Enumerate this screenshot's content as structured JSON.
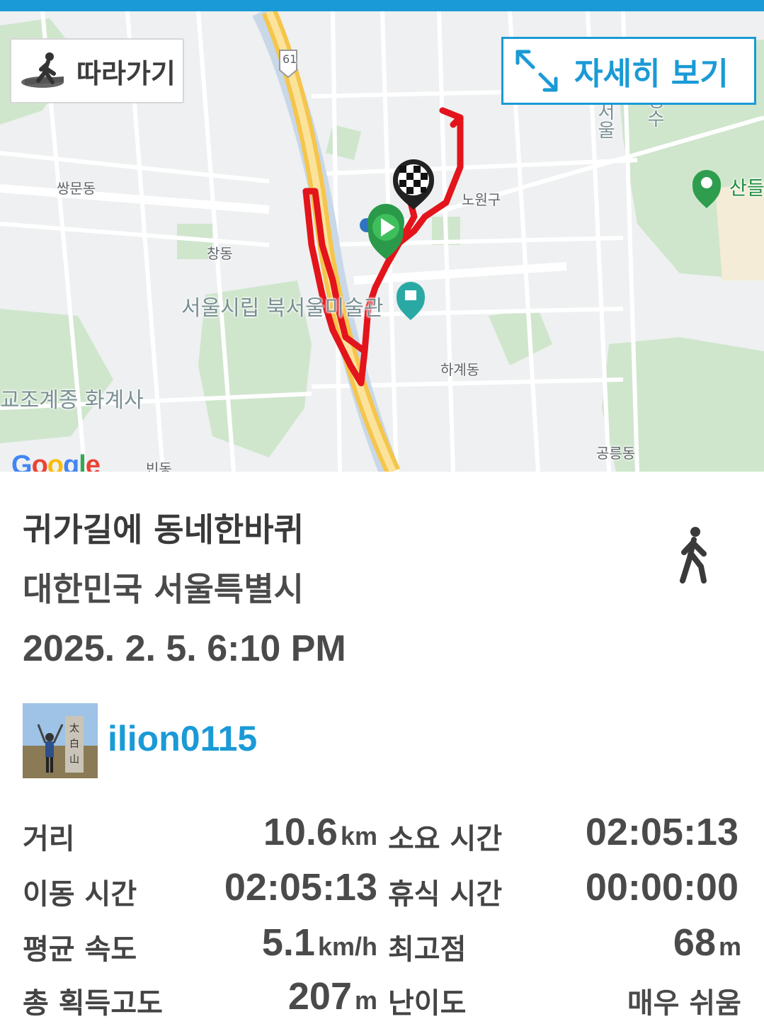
{
  "map": {
    "follow_label": "따라가기",
    "detail_label": "자세히 보기",
    "labels": {
      "ssangmun": "쌍문동",
      "nowon": "노원구",
      "chang": "창동",
      "museum": "서울시립 북서울미술관",
      "hagye": "하계동",
      "hwagyesa": "교조계종 화계사",
      "gongneung": "공릉동",
      "bin": "빈동",
      "san": "산들",
      "route61": "61",
      "seoul_vertical": "서울",
      "jung_vertical": "정수"
    },
    "google": [
      "G",
      "o",
      "o",
      "g",
      "l",
      "e"
    ],
    "route_color": "#e3141b",
    "accent_color": "#1a9ad6"
  },
  "track": {
    "title": "귀가길에 동네한바퀴",
    "region": "대한민국 서울특별시",
    "date": "2025. 2. 5. 6:10 PM",
    "activity_icon": "walking-icon",
    "username": "ilion0115"
  },
  "stats": {
    "distance": {
      "label": "거리",
      "value": "10.6",
      "unit": "km"
    },
    "elapsed": {
      "label": "소요 시간",
      "value": "02:05:13"
    },
    "moving": {
      "label": "이동 시간",
      "value": "02:05:13"
    },
    "rest": {
      "label": "휴식 시간",
      "value": "00:00:00"
    },
    "avg_speed": {
      "label": "평균 속도",
      "value": "5.1",
      "unit": "km/h"
    },
    "max_alt": {
      "label": "최고점",
      "value": "68",
      "unit": "m"
    },
    "gain": {
      "label": "총 획득고도",
      "value": "207",
      "unit": "m"
    },
    "difficulty": {
      "label": "난이도",
      "value": "매우 쉬움"
    }
  }
}
